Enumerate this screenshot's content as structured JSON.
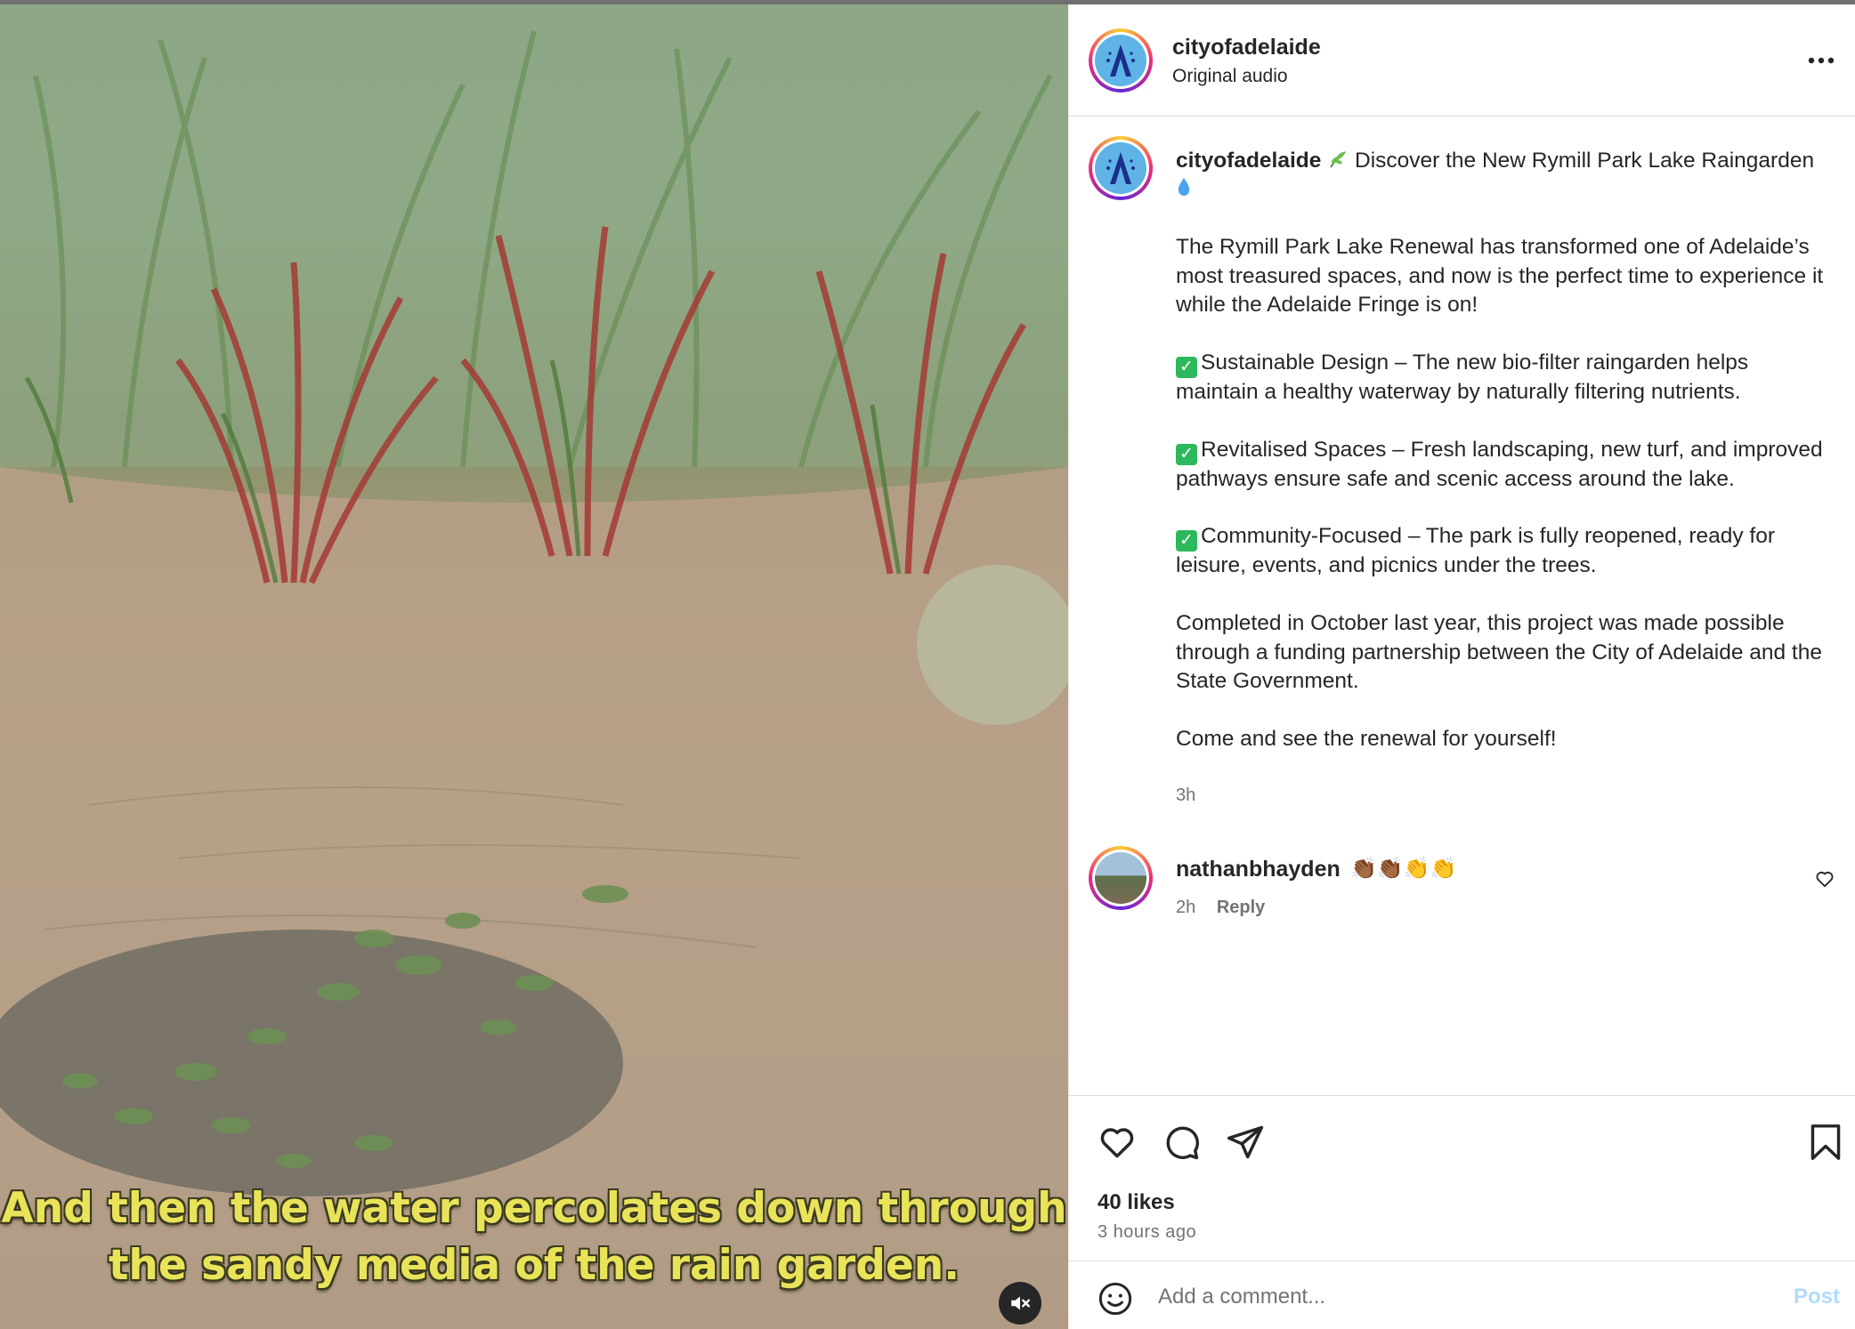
{
  "video": {
    "caption_line1": "And then the water percolates down through",
    "caption_line2": "the sandy media of the rain garden.",
    "mute_icon": "speaker-muted-icon"
  },
  "post": {
    "author": "cityofadelaide",
    "audio_label": "Original audio",
    "more_icon": "more-horizontal-icon",
    "caption": {
      "username": "cityofadelaide",
      "headline": "Discover the New Rymill Park Lake Raingarden",
      "p1": "The Rymill Park Lake Renewal has transformed one of Adelaide’s most treasured spaces, and now is the perfect time to experience it while the Adelaide Fringe is on!",
      "p2": "Sustainable Design – The new bio-filter raingarden helps maintain a healthy waterway by naturally filtering nutrients.",
      "p3": "Revitalised Spaces – Fresh landscaping, new turf, and improved pathways ensure safe and scenic access around the lake.",
      "p4": "Community-Focused – The park is fully reopened, ready for leisure, events, and picnics under the trees.",
      "p5": "Completed in October last year, this project was made possible through a funding partnership between the City of Adelaide and the State Government.",
      "p6": "Come and see the renewal for yourself!",
      "time": "3h"
    },
    "comments": [
      {
        "username": "nathanbhayden",
        "text": "👏🏾👏🏾👏👏",
        "time": "2h",
        "reply_label": "Reply"
      }
    ],
    "likes": "40 likes",
    "time_ago": "3 hours ago",
    "add_comment_placeholder": "Add a comment...",
    "post_label": "Post",
    "colors": {
      "post_disabled": "#b3dbff",
      "muted_text": "#737373",
      "check_green": "#2eb85c"
    }
  }
}
